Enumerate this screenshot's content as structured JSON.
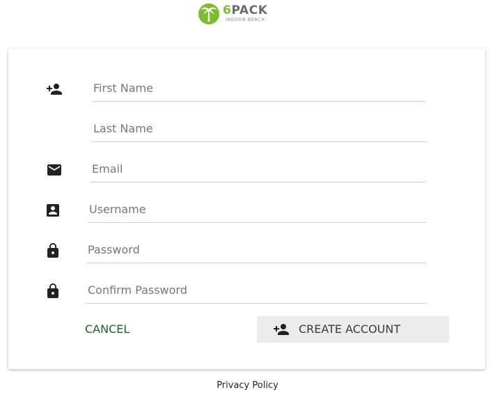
{
  "brand": {
    "name_prefix": "6",
    "name": "PACK",
    "tagline": "INDOOR BEACH",
    "colors": {
      "green": "#7bbd2e",
      "dark_green": "#1e5e2a",
      "grey": "#6b6b6b"
    }
  },
  "form": {
    "fields": [
      {
        "key": "first_name",
        "placeholder": "First Name",
        "value": "",
        "icon": "add-person-icon"
      },
      {
        "key": "last_name",
        "placeholder": "Last Name",
        "value": "",
        "icon": ""
      },
      {
        "key": "email",
        "placeholder": "Email",
        "value": "",
        "icon": "mail-icon"
      },
      {
        "key": "username",
        "placeholder": "Username",
        "value": "",
        "icon": "account-box-icon"
      },
      {
        "key": "password",
        "placeholder": "Password",
        "value": "",
        "icon": "lock-icon"
      },
      {
        "key": "confirm_password",
        "placeholder": "Confirm Password",
        "value": "",
        "icon": "lock-icon"
      }
    ],
    "cancel_label": "CANCEL",
    "create_label": "CREATE ACCOUNT",
    "create_icon": "add-person-icon"
  },
  "footer": {
    "privacy_label": "Privacy Policy"
  }
}
